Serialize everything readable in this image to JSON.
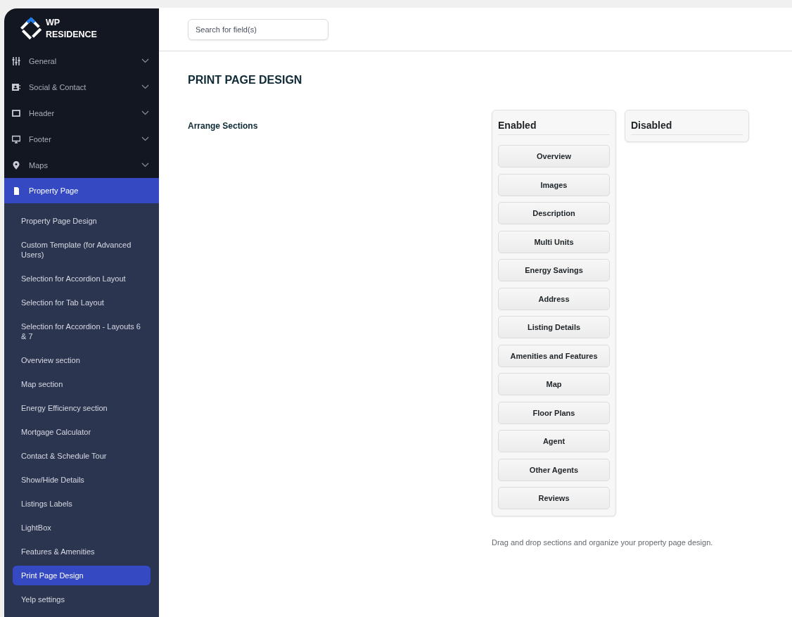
{
  "logo": {
    "line_1": "WP",
    "line_2": "RESIDENCE"
  },
  "sidebar": {
    "items": [
      {
        "label": "General",
        "selected": false,
        "expanded": false
      },
      {
        "label": "Social & Contact",
        "selected": false,
        "expanded": false
      },
      {
        "label": "Header",
        "selected": false,
        "expanded": false
      },
      {
        "label": "Footer",
        "selected": false,
        "expanded": false
      },
      {
        "label": "Maps",
        "selected": false,
        "expanded": false
      },
      {
        "label": "Property Page",
        "selected": true,
        "expanded": true,
        "children": [
          {
            "label": "Property Page Design",
            "selected": false
          },
          {
            "label": "Custom Template (for Advanced Users)",
            "selected": false
          },
          {
            "label": "Selection for Accordion Layout",
            "selected": false
          },
          {
            "label": "Selection for Tab Layout",
            "selected": false
          },
          {
            "label": "Selection for Accordion - Layouts 6 & 7",
            "selected": false
          },
          {
            "label": "Overview section",
            "selected": false
          },
          {
            "label": "Map section",
            "selected": false
          },
          {
            "label": "Energy Efficiency section",
            "selected": false
          },
          {
            "label": "Mortgage Calculator",
            "selected": false
          },
          {
            "label": "Contact & Schedule Tour",
            "selected": false
          },
          {
            "label": "Show/Hide Details",
            "selected": false
          },
          {
            "label": "Listings Labels",
            "selected": false
          },
          {
            "label": "LightBox",
            "selected": false
          },
          {
            "label": "Features & Amenities",
            "selected": false
          },
          {
            "label": "Print Page Design",
            "selected": true
          },
          {
            "label": "Yelp settings",
            "selected": false
          }
        ]
      }
    ]
  },
  "search": {
    "placeholder": "Search for field(s)"
  },
  "page_title": "PRINT PAGE DESIGN",
  "field_label": "Arrange Sections",
  "enabled": {
    "title": "Enabled",
    "items": [
      "Overview",
      "Images",
      "Description",
      "Multi Units",
      "Energy Savings",
      "Address",
      "Listing Details",
      "Amenities and Features",
      "Map",
      "Floor Plans",
      "Agent",
      "Other Agents",
      "Reviews"
    ]
  },
  "disabled": {
    "title": "Disabled"
  },
  "help_text": "Drag and drop sections and organize your property page design."
}
